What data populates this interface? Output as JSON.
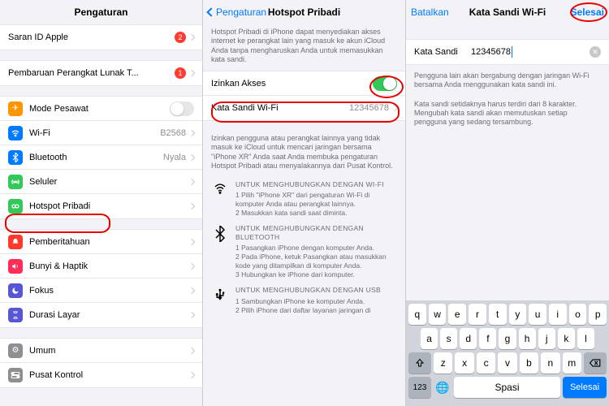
{
  "col1": {
    "title": "Pengaturan",
    "rows": {
      "appleid": {
        "label": "Saran ID Apple",
        "badge": "2"
      },
      "update": {
        "label": "Pembaruan Perangkat Lunak T...",
        "badge": "1"
      },
      "airplane": {
        "label": "Mode Pesawat"
      },
      "wifi": {
        "label": "Wi-Fi",
        "value": "B2568"
      },
      "bt": {
        "label": "Bluetooth",
        "value": "Nyala"
      },
      "cell": {
        "label": "Seluler"
      },
      "hotspot": {
        "label": "Hotspot Pribadi"
      },
      "notif": {
        "label": "Pemberitahuan"
      },
      "sound": {
        "label": "Bunyi & Haptik"
      },
      "focus": {
        "label": "Fokus"
      },
      "screen": {
        "label": "Durasi Layar"
      },
      "general": {
        "label": "Umum"
      },
      "control": {
        "label": "Pusat Kontrol"
      }
    }
  },
  "col2": {
    "back": "Pengaturan",
    "title": "Hotspot Pribadi",
    "intro": "Hotspot Pribadi di iPhone dapat menyediakan akses internet ke perangkat lain yang masuk ke akun iCloud Anda tanpa mengharuskan Anda untuk memasukkan kata sandi.",
    "allow": {
      "label": "Izinkan Akses"
    },
    "pwd": {
      "label": "Kata Sandi Wi-Fi",
      "value": "12345678"
    },
    "note2": "Izinkan pengguna atau perangkat lainnya yang tidak masuk ke iCloud untuk mencari jaringan bersama \"iPhone XR\" Anda saat Anda membuka pengaturan Hotspot Pribadi atau menyalakannya dari Pusat Kontrol.",
    "wifi": {
      "hd": "UNTUK MENGHUBUNGKAN DENGAN WI-FI",
      "s1": "1 Pilih \"iPhone XR\" dari pengaturan Wi-Fi di komputer Anda atau perangkat lainnya.",
      "s2": "2 Masukkan kata sandi saat diminta."
    },
    "bt": {
      "hd": "UNTUK MENGHUBUNGKAN DENGAN BLUETOOTH",
      "s1": "1 Pasangkan iPhone dengan komputer Anda.",
      "s2": "2 Pada iPhone, ketuk Pasangkan atau masukkan kode yang ditampilkan di komputer Anda.",
      "s3": "3 Hubungkan ke iPhone dari komputer."
    },
    "usb": {
      "hd": "UNTUK MENGHUBUNGKAN DENGAN USB",
      "s1": "1 Sambungkan iPhone ke komputer Anda.",
      "s2": "2 Pilih iPhone dari daftar layanan jaringan di"
    }
  },
  "col3": {
    "cancel": "Batalkan",
    "title": "Kata Sandi Wi-Fi",
    "done": "Selesai",
    "field_label": "Kata Sandi",
    "field_value": "12345678",
    "note1": "Pengguna lain akan bergabung dengan jaringan Wi-Fi bersama Anda menggunakan kata sandi ini.",
    "note2": "Kata sandi setidaknya harus terdiri dari 8 karakter. Mengubah kata sandi akan memutuskan setiap pengguna yang sedang tersambung.",
    "keys": {
      "r1": [
        "q",
        "w",
        "e",
        "r",
        "t",
        "y",
        "u",
        "i",
        "o",
        "p"
      ],
      "r2": [
        "a",
        "s",
        "d",
        "f",
        "g",
        "h",
        "j",
        "k",
        "l"
      ],
      "r3": [
        "z",
        "x",
        "c",
        "v",
        "b",
        "n",
        "m"
      ],
      "num": "123",
      "space": "Spasi",
      "ret": "Selesai"
    }
  }
}
